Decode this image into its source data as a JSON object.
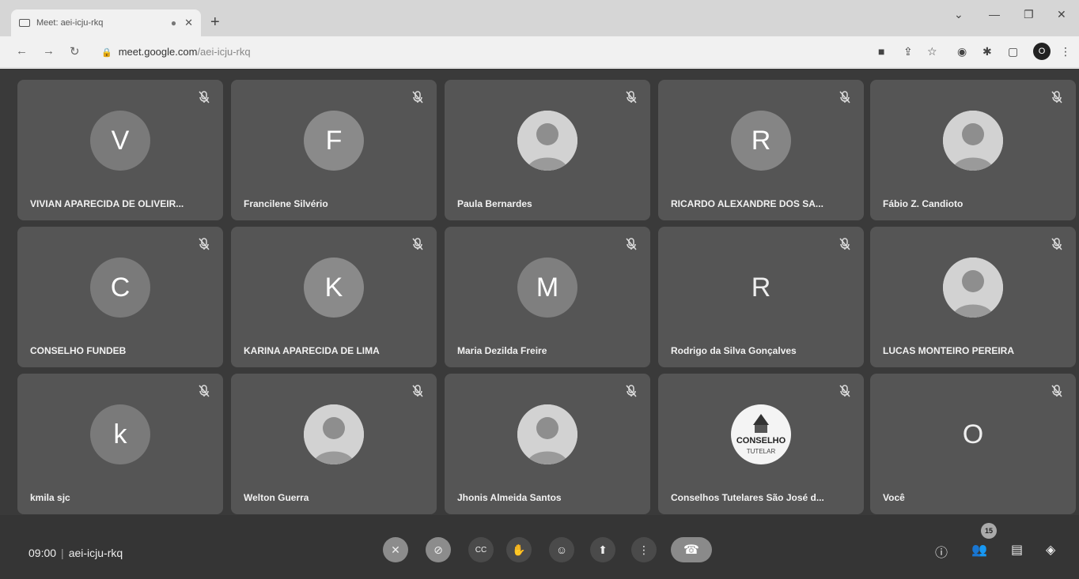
{
  "browser": {
    "tab_title": "Meet: aei-icju-rkq",
    "url_host": "meet.google.com",
    "url_path": "/aei-icju-rkq",
    "profile_initial": "O"
  },
  "participants": [
    {
      "name": "VIVIAN APARECIDA DE OLIVEIR...",
      "initial": "V",
      "avatar": "initial"
    },
    {
      "name": "Francilene Silvério",
      "initial": "F",
      "avatar": "initial"
    },
    {
      "name": "Paula Bernardes",
      "initial": "",
      "avatar": "photo"
    },
    {
      "name": "RICARDO ALEXANDRE DOS SA...",
      "initial": "R",
      "avatar": "initial"
    },
    {
      "name": "Fábio Z. Candioto",
      "initial": "",
      "avatar": "photo"
    },
    {
      "name": "CONSELHO FUNDEB",
      "initial": "C",
      "avatar": "initial"
    },
    {
      "name": "KARINA APARECIDA DE LIMA",
      "initial": "K",
      "avatar": "initial"
    },
    {
      "name": "Maria Dezilda Freire",
      "initial": "M",
      "avatar": "initial"
    },
    {
      "name": "Rodrigo da Silva Gonçalves",
      "initial": "R",
      "avatar": "plain"
    },
    {
      "name": "LUCAS MONTEIRO PEREIRA",
      "initial": "",
      "avatar": "photo"
    },
    {
      "name": "kmila sjc",
      "initial": "k",
      "avatar": "initial"
    },
    {
      "name": "Welton Guerra",
      "initial": "",
      "avatar": "photo"
    },
    {
      "name": "Jhonis Almeida Santos",
      "initial": "",
      "avatar": "photo"
    },
    {
      "name": "Conselhos Tutelares São José d...",
      "initial": "",
      "avatar": "logo",
      "logo_text": "CONSELHO"
    },
    {
      "name": "Você",
      "initial": "O",
      "avatar": "plain"
    }
  ],
  "meeting": {
    "time": "09:00",
    "code": "aei-icju-rkq",
    "participant_count": "15"
  },
  "controls": [
    {
      "name": "mic-button",
      "icon": "mic-off-icon",
      "glyph": "✕"
    },
    {
      "name": "camera-button",
      "icon": "camera-off-icon",
      "glyph": "⊘"
    },
    {
      "name": "captions-button",
      "icon": "captions-icon",
      "glyph": "CC"
    },
    {
      "name": "raise-hand-button",
      "icon": "hand-icon",
      "glyph": "✋"
    },
    {
      "name": "reactions-button",
      "icon": "emoji-icon",
      "glyph": "☺"
    },
    {
      "name": "present-button",
      "icon": "present-icon",
      "glyph": "⬆"
    },
    {
      "name": "more-options-button",
      "icon": "more-vert-icon",
      "glyph": "⋮"
    }
  ]
}
